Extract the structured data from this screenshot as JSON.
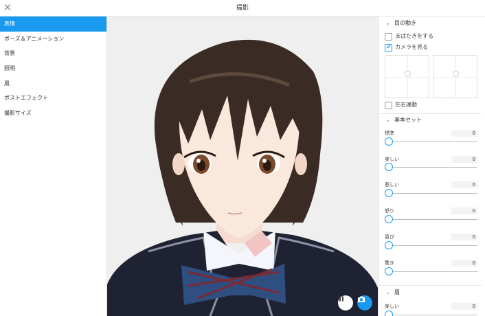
{
  "window": {
    "title": "撮影",
    "close_glyph": "✕"
  },
  "sidebar": {
    "items": [
      {
        "label": "表情",
        "active": true
      },
      {
        "label": "ポーズ＆アニメーション"
      },
      {
        "label": "背景"
      },
      {
        "label": "照明"
      },
      {
        "label": "風"
      },
      {
        "label": "ポストエフェクト"
      },
      {
        "label": "撮影サイズ"
      }
    ]
  },
  "viewport": {
    "pause_icon": "pause-icon",
    "camera_icon": "camera-icon"
  },
  "panel": {
    "eye_section": {
      "title": "目の動き",
      "chevron": "⌄",
      "blink_label": "まばたきをする",
      "blink_checked": false,
      "look_camera_label": "カメラを見る",
      "look_camera_checked": true,
      "sync_label": "左右連動",
      "sync_checked": false
    },
    "basic_section": {
      "title": "基本セット",
      "chevron": "⌄",
      "sliders": [
        {
          "label": "標準",
          "value": "0"
        },
        {
          "label": "楽しい",
          "value": "0"
        },
        {
          "label": "悲しい",
          "value": "0"
        },
        {
          "label": "怒り",
          "value": "0"
        },
        {
          "label": "喜び",
          "value": "0"
        },
        {
          "label": "驚き",
          "value": "0"
        }
      ]
    },
    "brow_section": {
      "title": "眉",
      "chevron": "⌄",
      "sliders": [
        {
          "label": "楽しい",
          "value": "0"
        }
      ]
    }
  },
  "colors": {
    "accent": "#1a9aef",
    "hair": "#3a2c25",
    "blazer": "#1f2233",
    "skin": "#fbe8dc"
  }
}
